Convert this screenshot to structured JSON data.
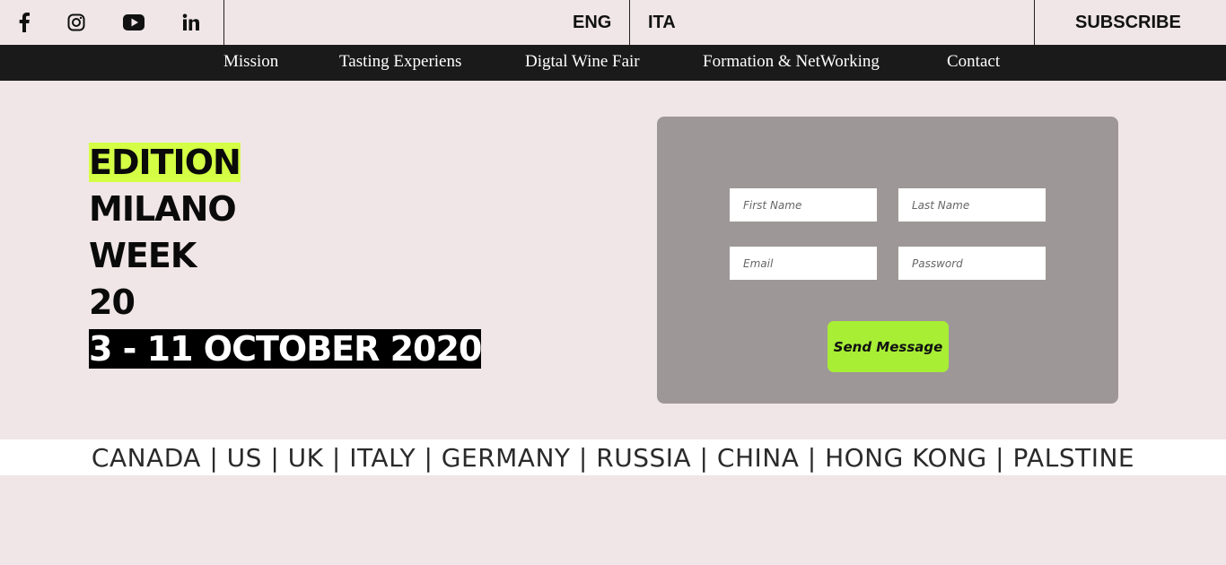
{
  "topbar": {
    "social": [
      {
        "name": "facebook-icon"
      },
      {
        "name": "instagram-icon"
      },
      {
        "name": "youtube-icon"
      },
      {
        "name": "linkedin-icon"
      }
    ],
    "lang_eng": "ENG",
    "lang_ita": "ITA",
    "subscribe": "SUBSCRIBE"
  },
  "nav": {
    "items": [
      "Mission",
      "Tasting Experiens",
      "Digtal Wine Fair",
      "Formation & NetWorking",
      "Contact"
    ]
  },
  "hero": {
    "line1": "EDITION",
    "line2": "MILANO",
    "line3": "WEEK",
    "line4": "20",
    "line5": "3 - 11 OCTOBER 2020",
    "highlight_green": "#d4ff44",
    "highlight_black": "#000000"
  },
  "form": {
    "first_name_placeholder": "First Name",
    "last_name_placeholder": "Last Name",
    "email_placeholder": "Email",
    "password_placeholder": "Password",
    "send_label": "Send Message",
    "panel_color": "#9e9797",
    "button_color": "#a7ee35"
  },
  "countries": {
    "text": "CANADA | US | UK | ITALY | GERMANY | RUSSIA | CHINA | HONG KONG | PALSTINE"
  }
}
